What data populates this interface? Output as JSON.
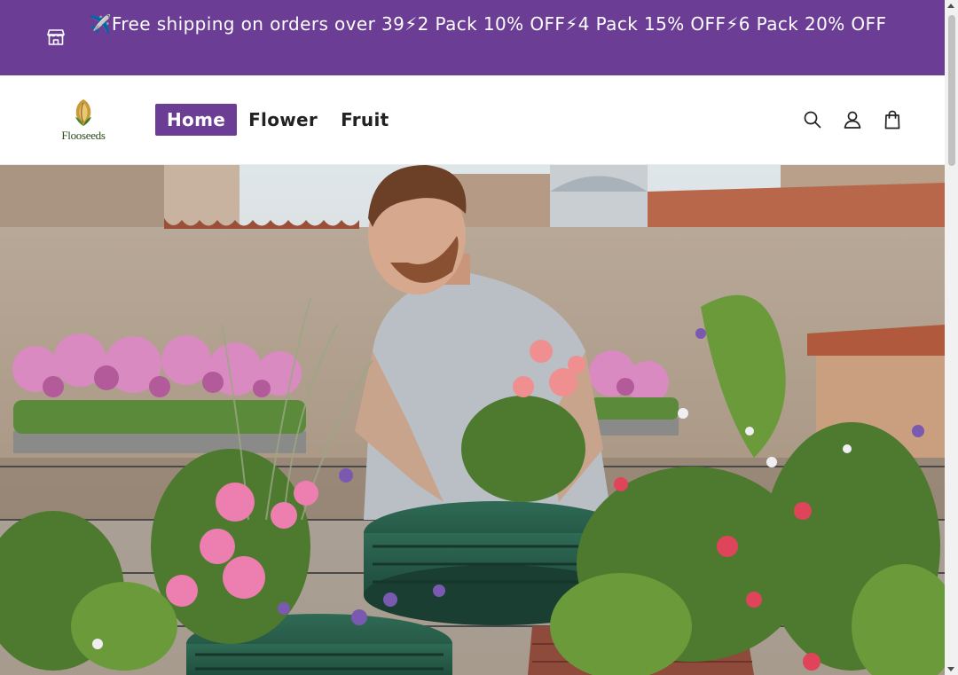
{
  "announcement": {
    "text": "✈️Free shipping on orders over 39⚡2 Pack 10% OFF⚡4 Pack 15% OFF⚡6 Pack 20% OFF",
    "icon": "store-icon",
    "background": "#6b3d95"
  },
  "header": {
    "logo_text": "Flooseeds",
    "nav": [
      {
        "label": "Home",
        "active": true
      },
      {
        "label": "Flower",
        "active": false
      },
      {
        "label": "Fruit",
        "active": false
      }
    ],
    "icons": [
      "search-icon",
      "account-icon",
      "cart-icon"
    ],
    "accent": "#6b3d95"
  },
  "hero": {
    "image": "man-planting-flowers-in-tire-planters-on-rooftop"
  }
}
